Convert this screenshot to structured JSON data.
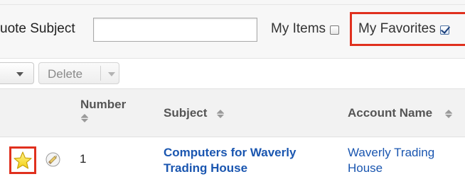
{
  "filters": {
    "quote_subject_label": "uote Subject",
    "quote_subject_value": "",
    "my_items_label": "My Items",
    "my_items_checked": false,
    "my_favorites_label": "My Favorites",
    "my_favorites_checked": true
  },
  "actions": {
    "delete_label": "Delete"
  },
  "table": {
    "columns": {
      "number": "Number",
      "subject": "Subject",
      "account_name": "Account Name"
    },
    "rows": [
      {
        "favorite": true,
        "number": "1",
        "subject": "Computers for Waverly Trading House",
        "account_name": "Waverly Trading House"
      }
    ]
  },
  "colors": {
    "highlight": "#e0301e",
    "link": "#1a56b0",
    "star_fill": "#f7e02a"
  },
  "icons": {
    "favorite": "star-icon",
    "edit": "pencil-icon",
    "sort": "sort-icon",
    "dropdown": "chevron-down-icon"
  }
}
